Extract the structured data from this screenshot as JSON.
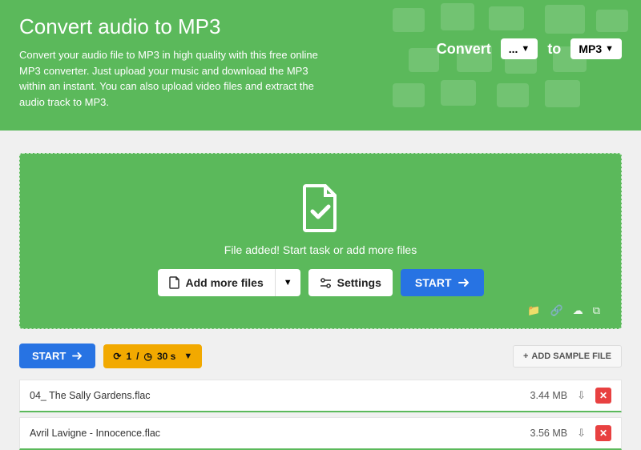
{
  "hero": {
    "title": "Convert audio to MP3",
    "desc": "Convert your audio file to MP3 in high quality with this free online MP3 converter. Just upload your music and download the MP3 within an instant. You can also upload video files and extract the audio track to MP3.",
    "convert_label": "Convert",
    "from_value": "...",
    "to_label": "to",
    "to_value": "MP3"
  },
  "dropzone": {
    "message": "File added! Start task or add more files",
    "add_more": "Add more files",
    "settings": "Settings",
    "start": "START"
  },
  "row2": {
    "start": "START",
    "repeat_count": "1",
    "repeat_time": "30 s",
    "sample": "ADD SAMPLE FILE"
  },
  "files": [
    {
      "name": "04_ The Sally Gardens.flac",
      "size": "3.44 MB"
    },
    {
      "name": "Avril Lavigne - Innocence.flac",
      "size": "3.56 MB"
    }
  ]
}
